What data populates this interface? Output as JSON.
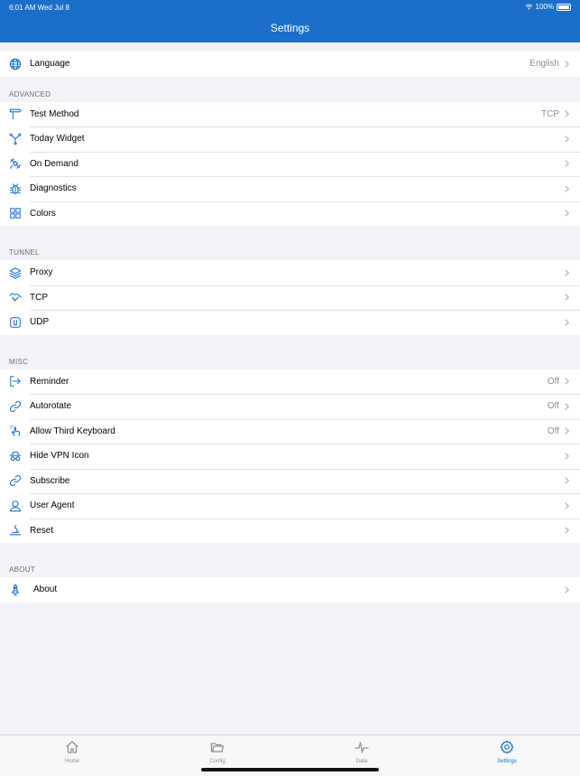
{
  "status_bar": {
    "time": "6:01 AM  Wed Jul 8",
    "battery": "100%"
  },
  "nav": {
    "title": "Settings"
  },
  "language": {
    "label": "Language",
    "value": "English"
  },
  "advanced": {
    "header": "ADVANCED",
    "test_method": {
      "label": "Test Method",
      "value": "TCP"
    },
    "today_widget": {
      "label": "Today Widget"
    },
    "on_demand": {
      "label": "On Demand"
    },
    "diagnostics": {
      "label": "Diagnostics"
    },
    "colors": {
      "label": "Colors"
    }
  },
  "tunnel": {
    "header": "TUNNEL",
    "proxy": {
      "label": "Proxy"
    },
    "tcp": {
      "label": "TCP"
    },
    "udp": {
      "label": "UDP"
    }
  },
  "misc": {
    "header": "MISC",
    "reminder": {
      "label": "Reminder",
      "value": "Off"
    },
    "autorotate": {
      "label": "Autorotate",
      "value": "Off"
    },
    "third_keyboard": {
      "label": "Allow Third Keyboard",
      "value": "Off"
    },
    "hide_vpn": {
      "label": "Hide VPN Icon"
    },
    "subscribe": {
      "label": "Subscribe"
    },
    "user_agent": {
      "label": "User Agent"
    },
    "reset": {
      "label": "Reset"
    }
  },
  "about": {
    "header": "ABOUT",
    "about": {
      "label": "About"
    }
  },
  "tabbar": {
    "home": "Home",
    "config": "Config",
    "data": "Data",
    "settings": "Settings"
  },
  "colors": {
    "accent": "#1b6fc9",
    "background": "#f2f2f7"
  }
}
